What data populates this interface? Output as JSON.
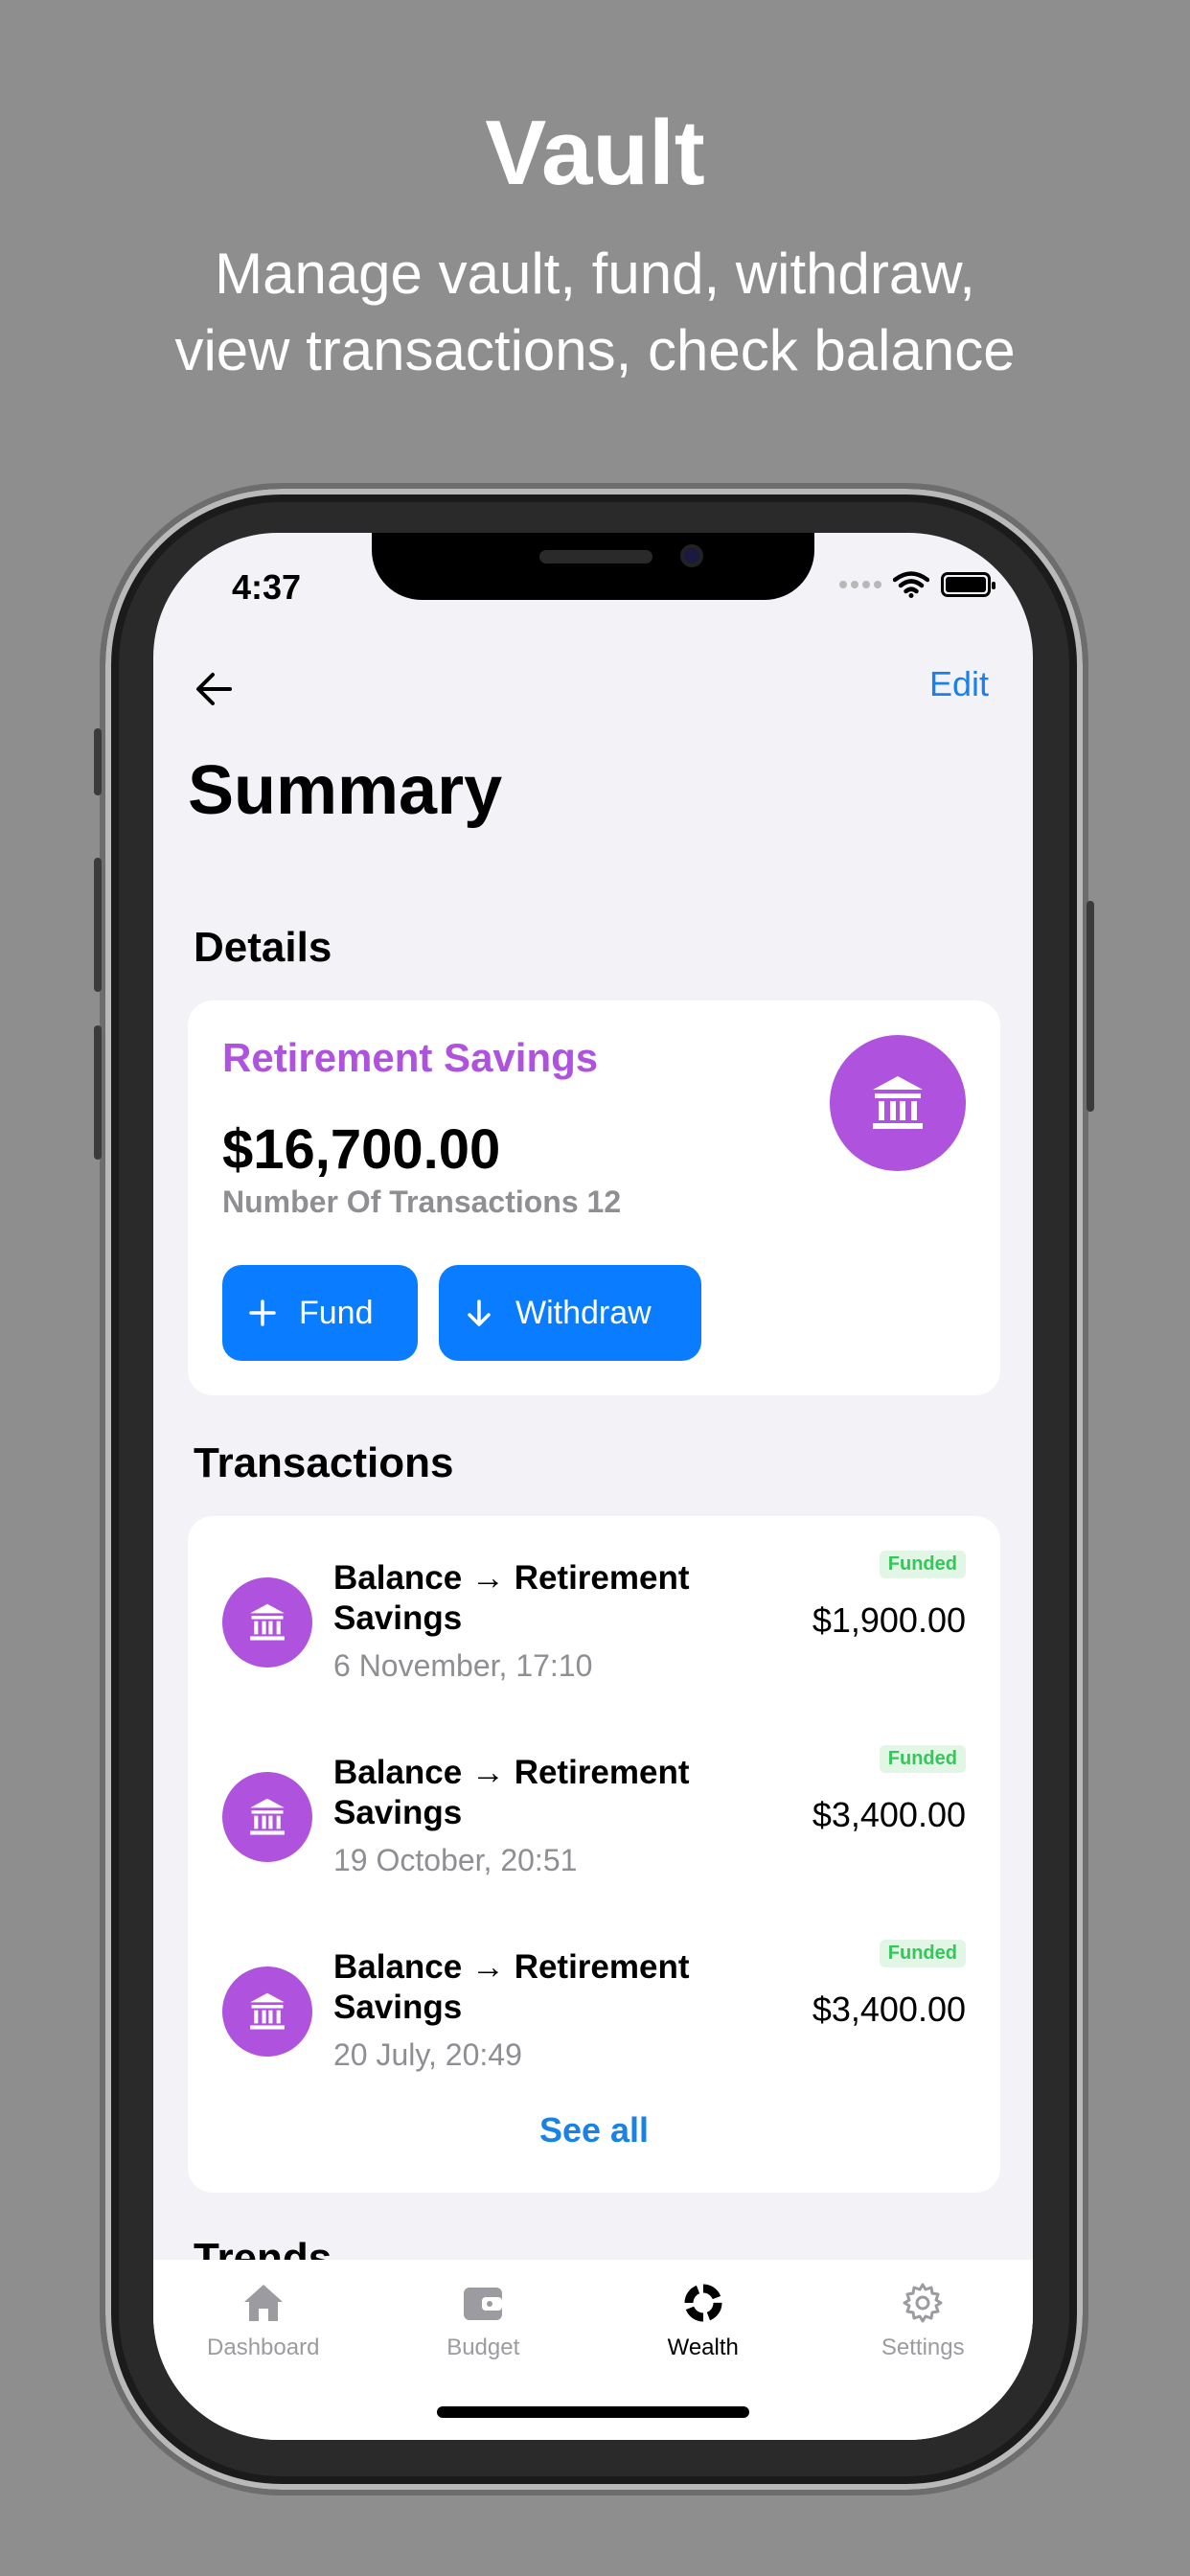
{
  "promo": {
    "title": "Vault",
    "subtitle_line1": "Manage vault, fund, withdraw,",
    "subtitle_line2": "view transactions, check balance"
  },
  "status_bar": {
    "time": "4:37"
  },
  "nav": {
    "edit_label": "Edit"
  },
  "page_title": "Summary",
  "details": {
    "section_title": "Details",
    "vault_name": "Retirement Savings",
    "balance": "$16,700.00",
    "transactions_count": "Number Of Transactions 12",
    "fund_label": "Fund",
    "withdraw_label": "Withdraw",
    "accent_color": "#af52de"
  },
  "transactions": {
    "section_title": "Transactions",
    "items": [
      {
        "title": "Balance → Retirement Savings",
        "date": "6 November, 17:10",
        "status": "Funded",
        "amount": "$1,900.00"
      },
      {
        "title": "Balance → Retirement Savings",
        "date": "19 October, 20:51",
        "status": "Funded",
        "amount": "$3,400.00"
      },
      {
        "title": "Balance → Retirement Savings",
        "date": "20 July, 20:49",
        "status": "Funded",
        "amount": "$3,400.00"
      }
    ],
    "see_all_label": "See all"
  },
  "trends": {
    "section_title": "Trends"
  },
  "tab_bar": {
    "items": [
      {
        "label": "Dashboard",
        "icon": "house-icon",
        "active": false
      },
      {
        "label": "Budget",
        "icon": "wallet-icon",
        "active": false
      },
      {
        "label": "Wealth",
        "icon": "wealth-ring-icon",
        "active": true
      },
      {
        "label": "Settings",
        "icon": "gear-icon",
        "active": false
      }
    ]
  },
  "colors": {
    "link": "#1a82e5",
    "button": "#0a7cff",
    "funded_badge": "#34c759"
  }
}
